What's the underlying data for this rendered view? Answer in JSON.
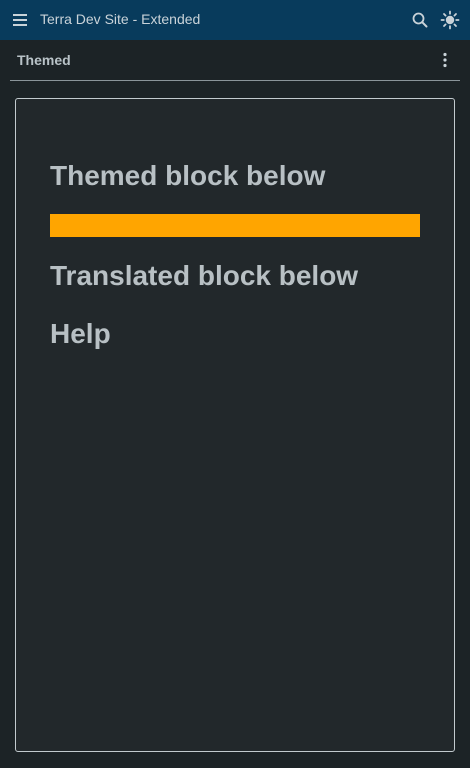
{
  "appbar": {
    "title": "Terra Dev Site - Extended",
    "menu_icon": "hamburger-menu-icon",
    "search_icon": "search-icon",
    "theme_icon": "sun-icon"
  },
  "toolbar": {
    "title": "Themed",
    "more_icon": "vertical-ellipsis-icon"
  },
  "content": {
    "themed_heading": "Themed block below",
    "translated_heading": "Translated block below",
    "help_heading": "Help"
  },
  "colors": {
    "appbar_bg": "#083b5c",
    "page_bg": "#1c2326",
    "card_bg": "#22282b",
    "themed_block": "#ffa500"
  }
}
